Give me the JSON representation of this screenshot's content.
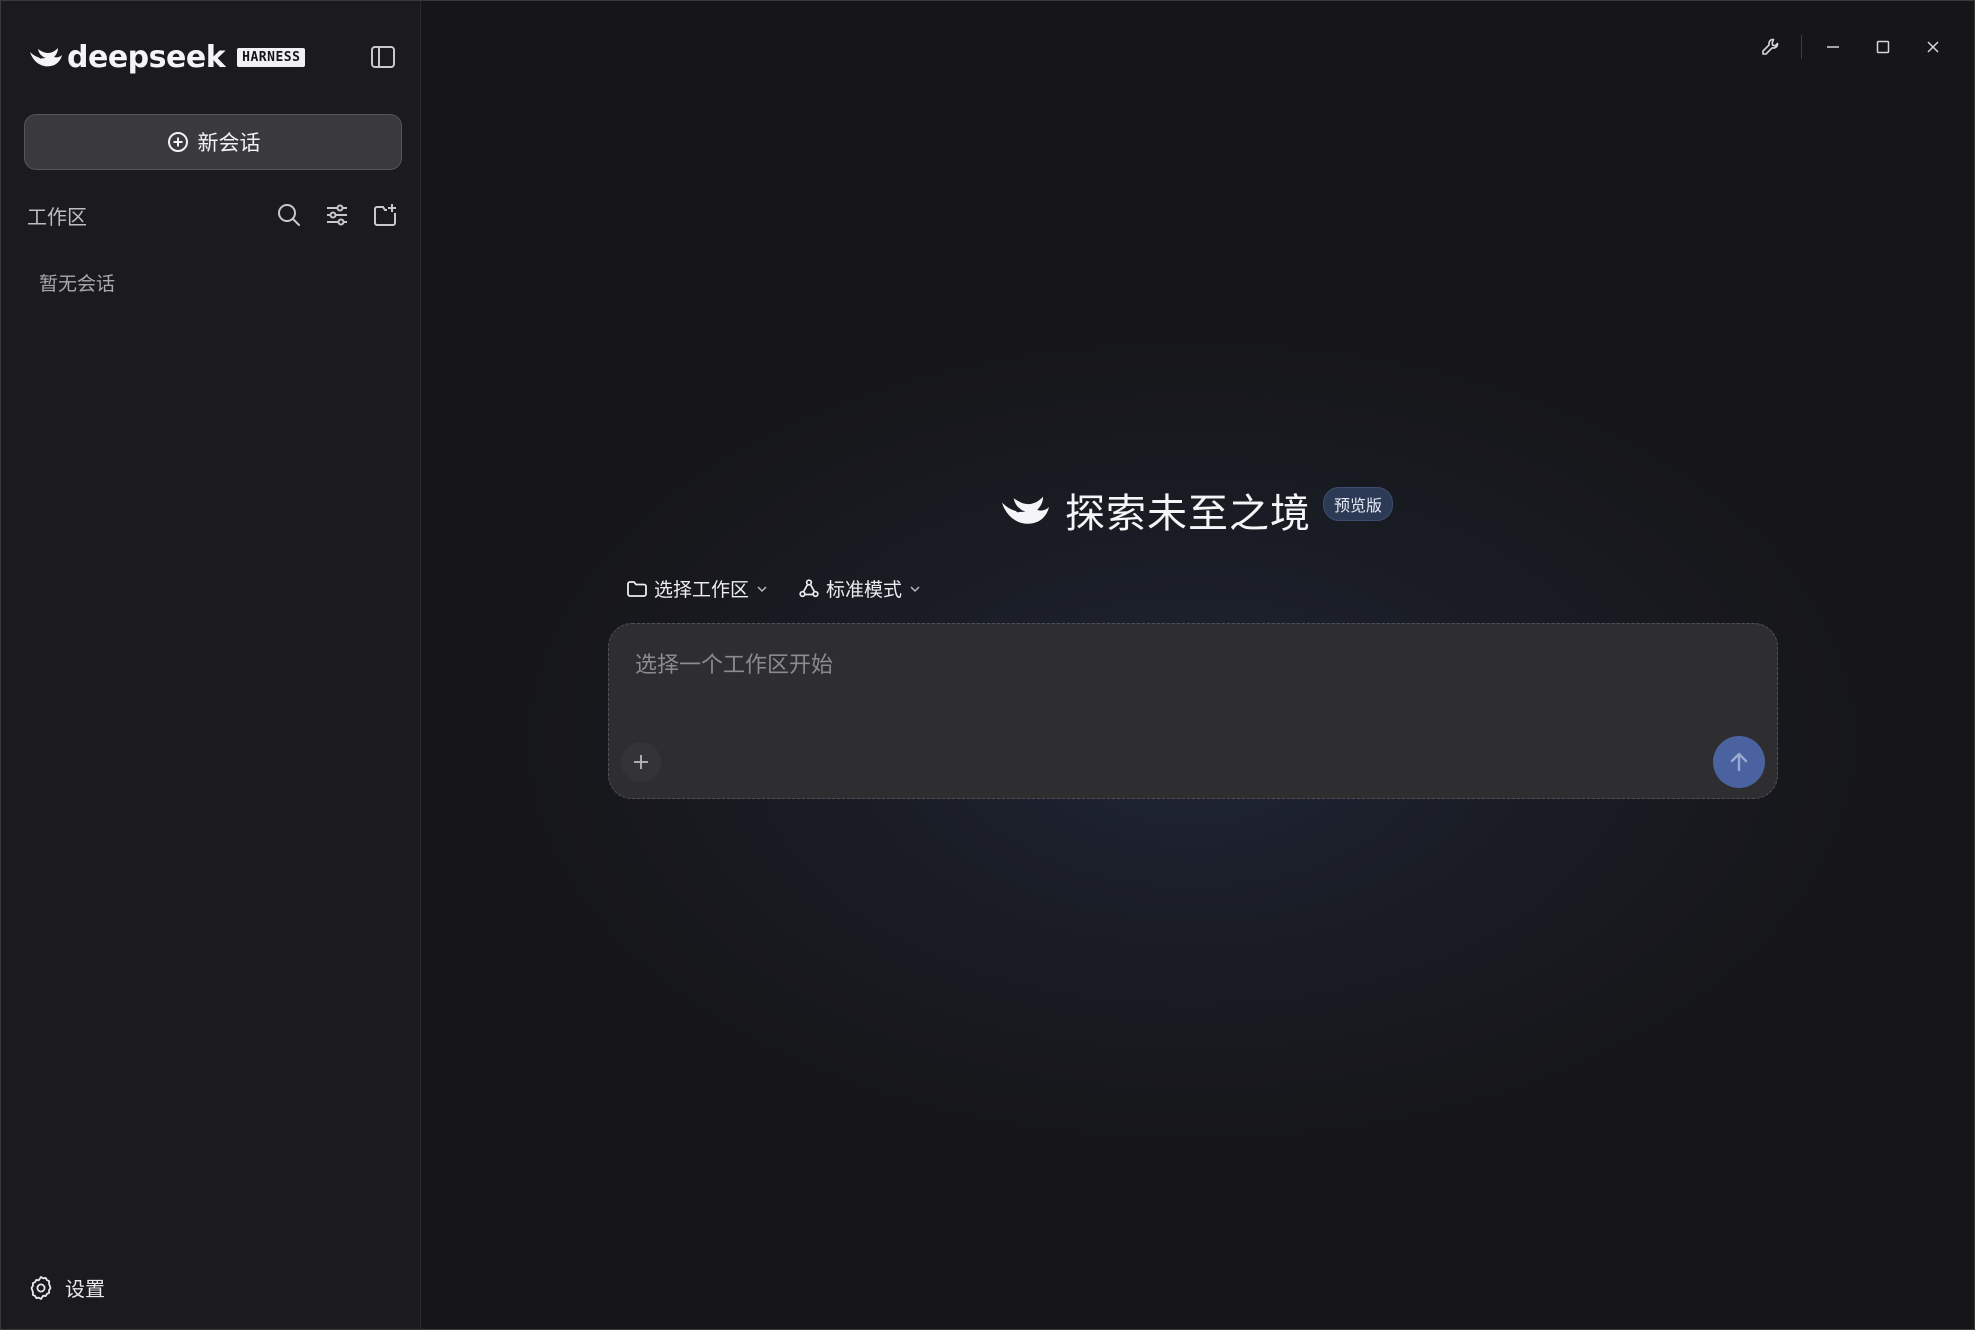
{
  "sidebar": {
    "brand_name": "deepseek",
    "brand_badge": "HARNESS",
    "brand_icon": "deepseek-whale-logo",
    "toggle_icon": "sidebar-panel-icon",
    "new_chat_label": "新会话",
    "new_chat_icon": "plus-circle-icon",
    "workspace_title": "工作区",
    "workspace_tools": [
      "search-icon",
      "filter-sliders-icon",
      "new-folder-icon"
    ],
    "empty_text": "暂无会话",
    "settings_label": "设置",
    "settings_icon": "gear-icon"
  },
  "titlebar": {
    "controls": [
      "wrench-icon",
      "minimize-icon",
      "maximize-icon",
      "close-icon"
    ]
  },
  "main": {
    "hero_title": "探索未至之境",
    "hero_badge": "预览版",
    "workspace_selector_label": "选择工作区",
    "mode_selector_label": "标准模式",
    "composer_placeholder": "选择一个工作区开始",
    "attach_icon": "plus-icon",
    "send_icon": "arrow-up-icon"
  },
  "colors": {
    "background": "#161619",
    "sidebar": "#1b1b1d",
    "composer": "#2e2e31",
    "send_button": "#4a62a0",
    "badge": "#2c3a55"
  }
}
